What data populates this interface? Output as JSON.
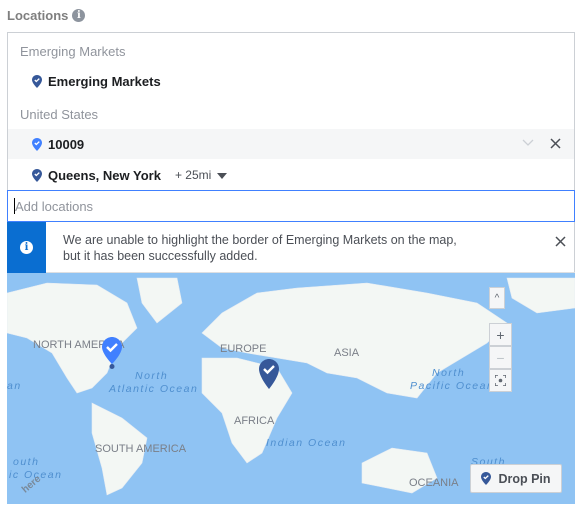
{
  "header": {
    "title": "Locations",
    "info_icon": "info-icon"
  },
  "groups": [
    {
      "label": "Emerging Markets",
      "items": [
        {
          "name": "Emerging Markets"
        }
      ]
    },
    {
      "label": "United States",
      "items": [
        {
          "name": "10009"
        },
        {
          "name": "Queens, New York",
          "radius": "+ 25mi"
        }
      ]
    }
  ],
  "input": {
    "placeholder": "Add locations"
  },
  "notice": {
    "text": "We are unable to highlight the border of Emerging Markets on the map, but it has been successfully added."
  },
  "map": {
    "labels": {
      "north_america": "NORTH AMERICA",
      "europe": "EUROPE",
      "asia": "ASIA",
      "africa": "AFRICA",
      "south_america": "SOUTH AMERICA",
      "oceania": "OCEANIA"
    },
    "oceans": {
      "north_atlantic_1": "North",
      "north_atlantic_2": "Atlantic Ocean",
      "indian": "Indian Ocean",
      "north_pacific_1": "North",
      "north_pacific_2": "Pacific Ocean",
      "south_pacific_1": "South",
      "south_atlantic_1": "outh",
      "south_atlantic_2": "ic Ocean",
      "left_edge": "an"
    },
    "controls": {
      "collapse": "^",
      "zoom_in": "+",
      "zoom_out": "−"
    },
    "drop_pin_label": "Drop Pin",
    "colors": {
      "water": "#8fc3f3",
      "land": "#f5f8f7",
      "pin_selected": "#4080ff",
      "pin_default": "#365899"
    }
  }
}
